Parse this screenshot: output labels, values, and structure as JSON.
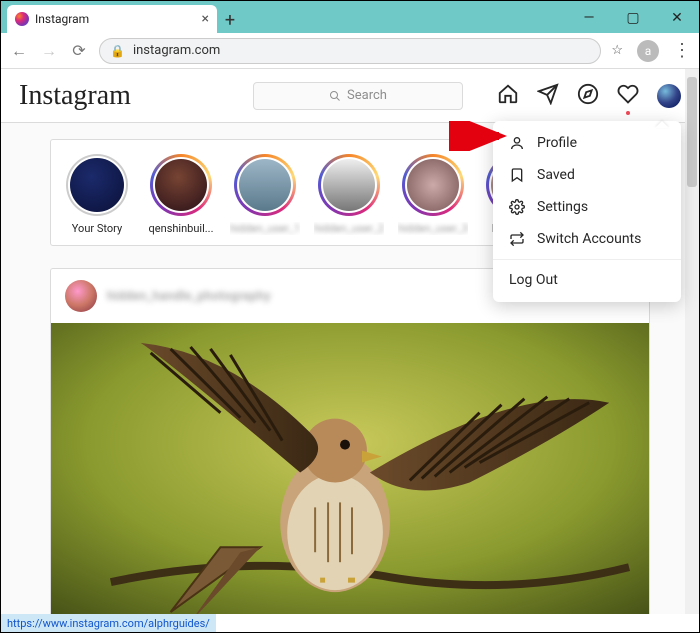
{
  "browser": {
    "tab_title": "Instagram",
    "url": "instagram.com",
    "profile_letter": "a",
    "status_url": "https://www.instagram.com/alphrguides/"
  },
  "header": {
    "logo_text": "Instagram",
    "search_placeholder": "Search"
  },
  "stories": [
    {
      "name": "Your Story",
      "own": true,
      "bg": "radial-gradient(circle at 40% 35%,#1b2a6b,#0a1038)"
    },
    {
      "name": "qenshinbuil...",
      "own": false,
      "bg": "radial-gradient(circle at 45% 35%,#743, #2a1018)"
    },
    {
      "name": "hidden_user_1",
      "own": false,
      "blur": true,
      "bg": "linear-gradient(#9db6c7,#5a7a8c)"
    },
    {
      "name": "hidden_user_2",
      "own": false,
      "blur": true,
      "bg": "linear-gradient(#eee,#777)"
    },
    {
      "name": "hidden_user_3",
      "own": false,
      "blur": true,
      "bg": "radial-gradient(circle,#caa,#755)"
    },
    {
      "name": "leomess...",
      "own": false,
      "bg": "linear-gradient(#c9a,#876)"
    }
  ],
  "dropdown": {
    "items": [
      {
        "icon": "profile",
        "label": "Profile"
      },
      {
        "icon": "saved",
        "label": "Saved"
      },
      {
        "icon": "settings",
        "label": "Settings"
      },
      {
        "icon": "switch",
        "label": "Switch Accounts"
      }
    ],
    "logout": "Log Out"
  },
  "post": {
    "username_hidden": "hidden_handle_photography",
    "more": "•••"
  }
}
